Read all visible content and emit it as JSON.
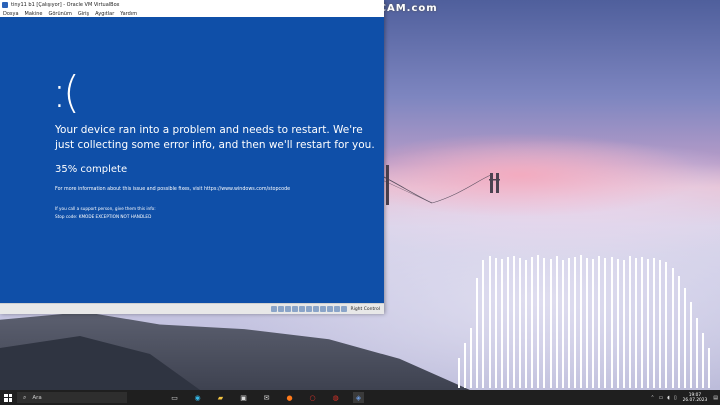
{
  "window": {
    "title": "tiny11 b1 [Çalışıyor] - Oracle VM VirtualBox",
    "menu": [
      "Dosya",
      "Makine",
      "Görünüm",
      "Giriş",
      "Aygıtlar",
      "Yardım"
    ]
  },
  "bsod": {
    "face": ":(",
    "message": "Your device ran into a problem and needs to restart. We're just collecting some error info, and then we'll restart for you.",
    "progress": "35% complete",
    "info": "For more information about this issue and possible fixes, visit https://www.windows.com/stopcode",
    "support": "If you call a support person, give them this info:",
    "stop_code": "Stop code: KMODE EXCEPTION NOT HANDLED"
  },
  "statusbar": {
    "host_key": "Right Control"
  },
  "watermark": "www.BANDICAM.com",
  "taskbar": {
    "search_placeholder": "Ara",
    "apps": [
      "file-explorer-icon",
      "edge-icon",
      "folder-icon",
      "store-icon",
      "mail-icon",
      "firefox-icon",
      "opera-icon",
      "record-icon",
      "virtualbox-icon"
    ],
    "clock_time": "19:07",
    "clock_date": "26.07.2023"
  },
  "colors": {
    "bsod_blue": "#0f4fa8",
    "taskbar": "#1f1f1f"
  }
}
